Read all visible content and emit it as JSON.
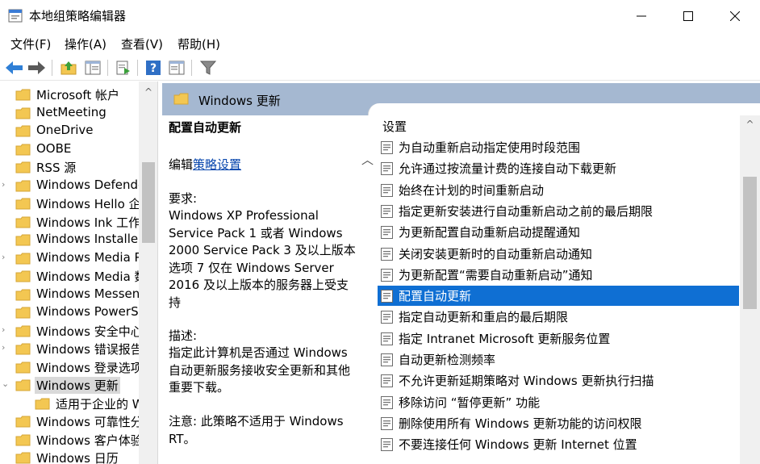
{
  "window": {
    "title": "本地组策略编辑器",
    "min_glyph": "—",
    "max_glyph": "☐",
    "close_glyph": "✕"
  },
  "menu": [
    "文件(F)",
    "操作(A)",
    "查看(V)",
    "帮助(H)"
  ],
  "toolbar": {
    "icons": [
      "back-arrow-icon",
      "forward-arrow-icon",
      "up-folder-icon",
      "show-hide-tree-icon",
      "export-list-icon",
      "help-icon",
      "show-hide-action-pane-icon",
      "filter-icon"
    ]
  },
  "tree": {
    "items": [
      {
        "label": "Microsoft 帐户",
        "indent": 0,
        "expander": ""
      },
      {
        "label": "NetMeeting",
        "indent": 0,
        "expander": ""
      },
      {
        "label": "OneDrive",
        "indent": 0,
        "expander": ""
      },
      {
        "label": "OOBE",
        "indent": 0,
        "expander": ""
      },
      {
        "label": "RSS 源",
        "indent": 0,
        "expander": ""
      },
      {
        "label": "Windows Defender",
        "indent": 0,
        "expander": "›"
      },
      {
        "label": "Windows Hello 企业",
        "indent": 0,
        "expander": ""
      },
      {
        "label": "Windows Ink 工作区",
        "indent": 0,
        "expander": ""
      },
      {
        "label": "Windows Installer",
        "indent": 0,
        "expander": ""
      },
      {
        "label": "Windows Media Player",
        "indent": 0,
        "expander": "›"
      },
      {
        "label": "Windows Media 数",
        "indent": 0,
        "expander": ""
      },
      {
        "label": "Windows Messenger",
        "indent": 0,
        "expander": ""
      },
      {
        "label": "Windows PowerShell",
        "indent": 0,
        "expander": ""
      },
      {
        "label": "Windows 安全中心",
        "indent": 0,
        "expander": "›"
      },
      {
        "label": "Windows 错误报告",
        "indent": 0,
        "expander": "›"
      },
      {
        "label": "Windows 登录选项",
        "indent": 0,
        "expander": ""
      },
      {
        "label": "Windows 更新",
        "indent": 0,
        "expander": "⌄",
        "selected": true
      },
      {
        "label": "适用于企业的 W",
        "indent": 1,
        "expander": ""
      },
      {
        "label": "Windows 可靠性分析",
        "indent": 0,
        "expander": ""
      },
      {
        "label": "Windows 客户体验",
        "indent": 0,
        "expander": ""
      },
      {
        "label": "Windows 日历",
        "indent": 0,
        "expander": ""
      }
    ],
    "scroll_up_glyph": "^"
  },
  "right_header": {
    "title": "Windows 更新"
  },
  "description": {
    "title": "配置自动更新",
    "edit_prefix": "编辑",
    "edit_link": "策略设置",
    "requirements_heading": "要求:",
    "requirements": "Windows XP Professional\nService Pack 1 或者 Windows\n2000 Service Pack 3 及以上版本\n选项 7 仅在 Windows Server\n2016 及以上版本的服务器上受支\n持",
    "desc_heading": "描述:",
    "desc": "指定此计算机是否通过 Windows\n自动更新服务接收安全更新和其他\n重要下载。",
    "note": "注意: 此策略不适用于 Windows\nRT。"
  },
  "settings": {
    "column_header": "设置",
    "scroll_up_glyph": "^",
    "items": [
      {
        "label": "为自动重新启动指定使用时段范围"
      },
      {
        "label": "允许通过按流量计费的连接自动下载更新"
      },
      {
        "label": "始终在计划的时间重新启动"
      },
      {
        "label": "指定更新安装进行自动重新启动之前的最后期限"
      },
      {
        "label": "为更新配置自动重新启动提醒通知"
      },
      {
        "label": "关闭安装更新时的自动重新启动通知"
      },
      {
        "label": "为更新配置“需要自动重新启动”通知"
      },
      {
        "label": "配置自动更新",
        "selected": true
      },
      {
        "label": "指定自动更新和重启的最后期限"
      },
      {
        "label": "指定 Intranet Microsoft 更新服务位置"
      },
      {
        "label": "自动更新检测频率"
      },
      {
        "label": "不允许更新延期策略对 Windows 更新执行扫描"
      },
      {
        "label": "移除访问 “暂停更新” 功能"
      },
      {
        "label": "删除使用所有 Windows 更新功能的访问权限"
      },
      {
        "label": "不要连接任何 Windows 更新 Internet 位置"
      }
    ]
  },
  "colors": {
    "header_bg": "#a5b8d1",
    "selection_bg": "#0f6fd3",
    "tree_selection_bg": "#d9d9d9",
    "folder_yellow": "#f3c752",
    "link": "#0645ad"
  }
}
